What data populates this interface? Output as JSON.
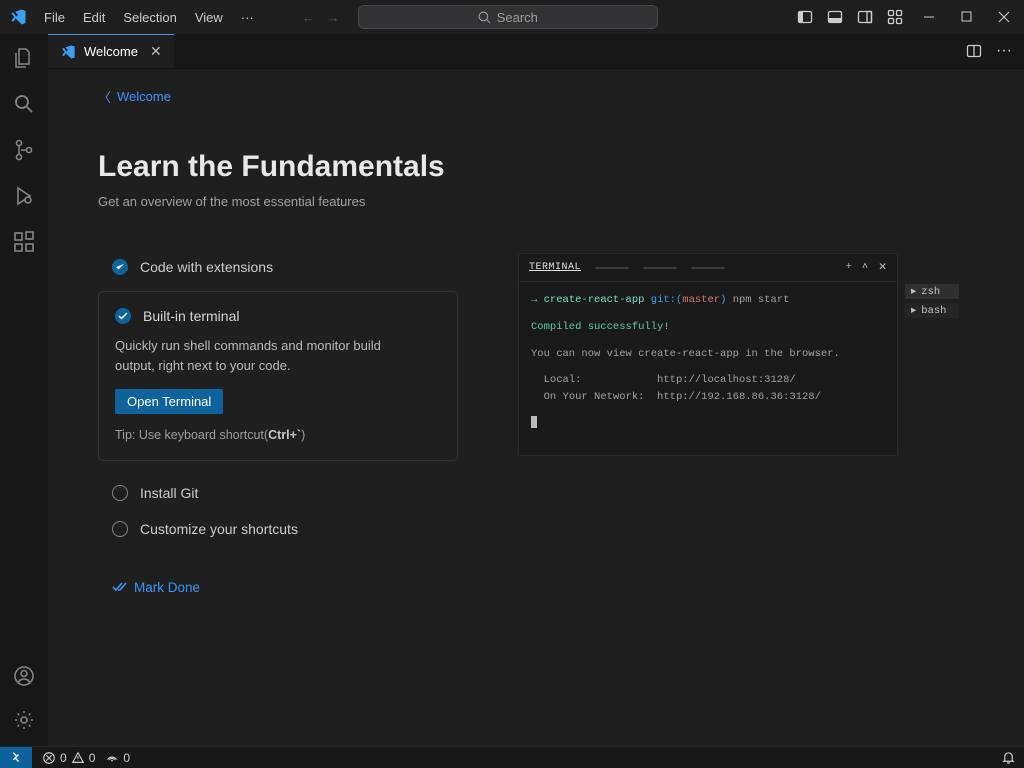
{
  "menu": {
    "file": "File",
    "edit": "Edit",
    "selection": "Selection",
    "view": "View"
  },
  "search": {
    "placeholder": "Search"
  },
  "tab": {
    "title": "Welcome"
  },
  "back": {
    "label": "Welcome"
  },
  "page": {
    "title": "Learn the Fundamentals",
    "subtitle": "Get an overview of the most essential features"
  },
  "steps": {
    "extensions": {
      "label": "Code with extensions"
    },
    "terminal": {
      "label": "Built-in terminal",
      "desc": "Quickly run shell commands and monitor build output, right next to your code.",
      "button": "Open Terminal",
      "tip_prefix": "Tip: Use keyboard shortcut(",
      "tip_key": "Ctrl+`",
      "tip_suffix": ")"
    },
    "git": {
      "label": "Install Git"
    },
    "shortcuts": {
      "label": "Customize your shortcuts"
    }
  },
  "mark_done": "Mark Done",
  "terminal_preview": {
    "tab": "TERMINAL",
    "line1": {
      "arrow": "→",
      "app": "create-react-app",
      "git": "git:(",
      "master": "master",
      "git2": ")",
      "cmd": " npm start"
    },
    "compiled": "Compiled successfully!",
    "line2": "You can now view create-react-app in the browser.",
    "local_label": "Local:",
    "local_url": "http://localhost:3128/",
    "network_label": "On Your Network:",
    "network_url": "http://192.168.86.36:3128/",
    "side": {
      "zsh": "zsh",
      "bash": "bash"
    }
  },
  "status": {
    "errors": "0",
    "warnings": "0",
    "ports": "0"
  }
}
